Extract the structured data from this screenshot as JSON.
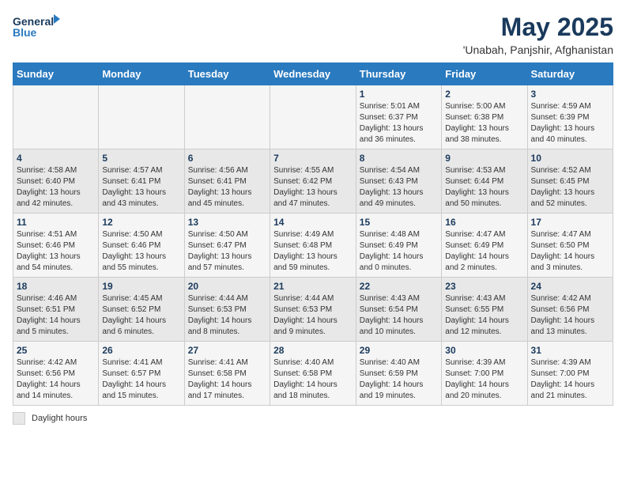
{
  "logo": {
    "line1": "General",
    "line2": "Blue"
  },
  "title": "May 2025",
  "subtitle": "'Unabah, Panjshir, Afghanistan",
  "days_of_week": [
    "Sunday",
    "Monday",
    "Tuesday",
    "Wednesday",
    "Thursday",
    "Friday",
    "Saturday"
  ],
  "footer": {
    "daylight_label": "Daylight hours"
  },
  "weeks": [
    [
      {
        "day": "",
        "info": ""
      },
      {
        "day": "",
        "info": ""
      },
      {
        "day": "",
        "info": ""
      },
      {
        "day": "",
        "info": ""
      },
      {
        "day": "1",
        "info": "Sunrise: 5:01 AM\nSunset: 6:37 PM\nDaylight: 13 hours\nand 36 minutes."
      },
      {
        "day": "2",
        "info": "Sunrise: 5:00 AM\nSunset: 6:38 PM\nDaylight: 13 hours\nand 38 minutes."
      },
      {
        "day": "3",
        "info": "Sunrise: 4:59 AM\nSunset: 6:39 PM\nDaylight: 13 hours\nand 40 minutes."
      }
    ],
    [
      {
        "day": "4",
        "info": "Sunrise: 4:58 AM\nSunset: 6:40 PM\nDaylight: 13 hours\nand 42 minutes."
      },
      {
        "day": "5",
        "info": "Sunrise: 4:57 AM\nSunset: 6:41 PM\nDaylight: 13 hours\nand 43 minutes."
      },
      {
        "day": "6",
        "info": "Sunrise: 4:56 AM\nSunset: 6:41 PM\nDaylight: 13 hours\nand 45 minutes."
      },
      {
        "day": "7",
        "info": "Sunrise: 4:55 AM\nSunset: 6:42 PM\nDaylight: 13 hours\nand 47 minutes."
      },
      {
        "day": "8",
        "info": "Sunrise: 4:54 AM\nSunset: 6:43 PM\nDaylight: 13 hours\nand 49 minutes."
      },
      {
        "day": "9",
        "info": "Sunrise: 4:53 AM\nSunset: 6:44 PM\nDaylight: 13 hours\nand 50 minutes."
      },
      {
        "day": "10",
        "info": "Sunrise: 4:52 AM\nSunset: 6:45 PM\nDaylight: 13 hours\nand 52 minutes."
      }
    ],
    [
      {
        "day": "11",
        "info": "Sunrise: 4:51 AM\nSunset: 6:46 PM\nDaylight: 13 hours\nand 54 minutes."
      },
      {
        "day": "12",
        "info": "Sunrise: 4:50 AM\nSunset: 6:46 PM\nDaylight: 13 hours\nand 55 minutes."
      },
      {
        "day": "13",
        "info": "Sunrise: 4:50 AM\nSunset: 6:47 PM\nDaylight: 13 hours\nand 57 minutes."
      },
      {
        "day": "14",
        "info": "Sunrise: 4:49 AM\nSunset: 6:48 PM\nDaylight: 13 hours\nand 59 minutes."
      },
      {
        "day": "15",
        "info": "Sunrise: 4:48 AM\nSunset: 6:49 PM\nDaylight: 14 hours\nand 0 minutes."
      },
      {
        "day": "16",
        "info": "Sunrise: 4:47 AM\nSunset: 6:49 PM\nDaylight: 14 hours\nand 2 minutes."
      },
      {
        "day": "17",
        "info": "Sunrise: 4:47 AM\nSunset: 6:50 PM\nDaylight: 14 hours\nand 3 minutes."
      }
    ],
    [
      {
        "day": "18",
        "info": "Sunrise: 4:46 AM\nSunset: 6:51 PM\nDaylight: 14 hours\nand 5 minutes."
      },
      {
        "day": "19",
        "info": "Sunrise: 4:45 AM\nSunset: 6:52 PM\nDaylight: 14 hours\nand 6 minutes."
      },
      {
        "day": "20",
        "info": "Sunrise: 4:44 AM\nSunset: 6:53 PM\nDaylight: 14 hours\nand 8 minutes."
      },
      {
        "day": "21",
        "info": "Sunrise: 4:44 AM\nSunset: 6:53 PM\nDaylight: 14 hours\nand 9 minutes."
      },
      {
        "day": "22",
        "info": "Sunrise: 4:43 AM\nSunset: 6:54 PM\nDaylight: 14 hours\nand 10 minutes."
      },
      {
        "day": "23",
        "info": "Sunrise: 4:43 AM\nSunset: 6:55 PM\nDaylight: 14 hours\nand 12 minutes."
      },
      {
        "day": "24",
        "info": "Sunrise: 4:42 AM\nSunset: 6:56 PM\nDaylight: 14 hours\nand 13 minutes."
      }
    ],
    [
      {
        "day": "25",
        "info": "Sunrise: 4:42 AM\nSunset: 6:56 PM\nDaylight: 14 hours\nand 14 minutes."
      },
      {
        "day": "26",
        "info": "Sunrise: 4:41 AM\nSunset: 6:57 PM\nDaylight: 14 hours\nand 15 minutes."
      },
      {
        "day": "27",
        "info": "Sunrise: 4:41 AM\nSunset: 6:58 PM\nDaylight: 14 hours\nand 17 minutes."
      },
      {
        "day": "28",
        "info": "Sunrise: 4:40 AM\nSunset: 6:58 PM\nDaylight: 14 hours\nand 18 minutes."
      },
      {
        "day": "29",
        "info": "Sunrise: 4:40 AM\nSunset: 6:59 PM\nDaylight: 14 hours\nand 19 minutes."
      },
      {
        "day": "30",
        "info": "Sunrise: 4:39 AM\nSunset: 7:00 PM\nDaylight: 14 hours\nand 20 minutes."
      },
      {
        "day": "31",
        "info": "Sunrise: 4:39 AM\nSunset: 7:00 PM\nDaylight: 14 hours\nand 21 minutes."
      }
    ]
  ]
}
